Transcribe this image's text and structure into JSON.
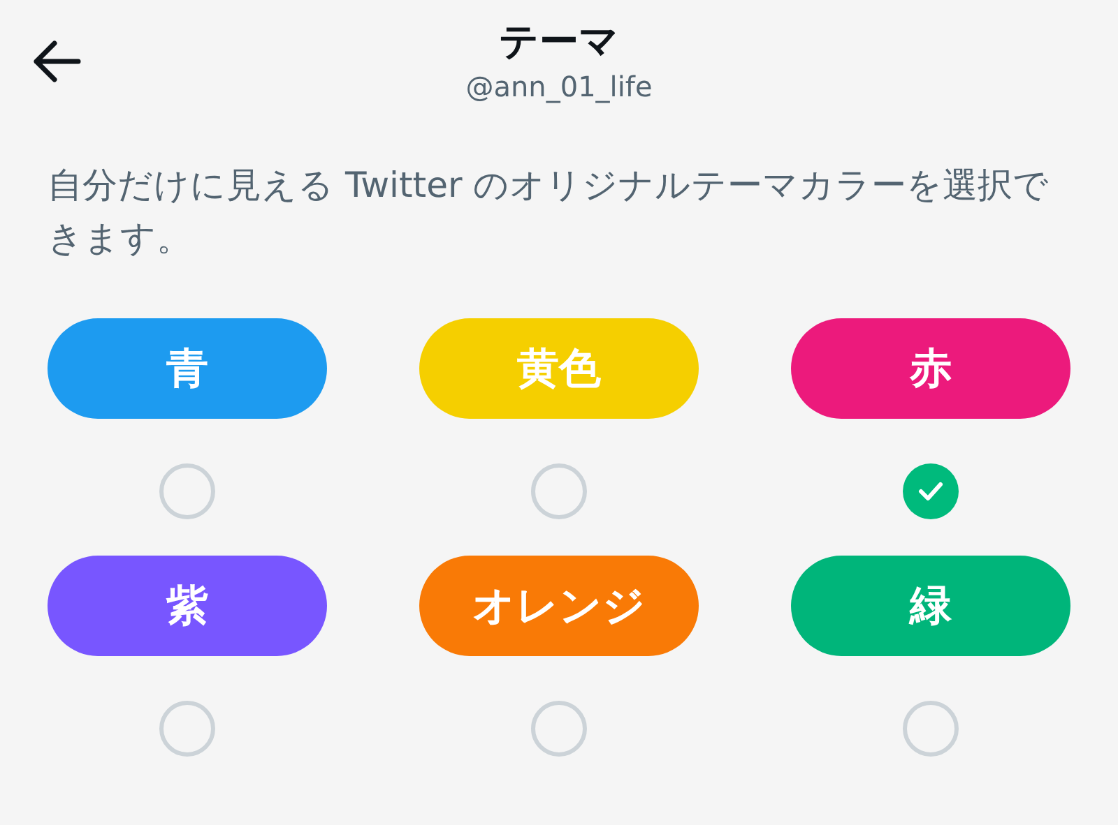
{
  "header": {
    "title": "テーマ",
    "handle": "@ann_01_life"
  },
  "description": "自分だけに見える Twitter のオリジナルテーマカラーを選択できます。",
  "themes": [
    {
      "label": "青",
      "color": "#1d9bf0",
      "selected": false
    },
    {
      "label": "黄色",
      "color": "#f5cf00",
      "selected": false
    },
    {
      "label": "赤",
      "color": "#ec1a7c",
      "selected": true
    },
    {
      "label": "紫",
      "color": "#7856ff",
      "selected": false
    },
    {
      "label": "オレンジ",
      "color": "#f97a06",
      "selected": false
    },
    {
      "label": "緑",
      "color": "#00b57a",
      "selected": false
    }
  ]
}
